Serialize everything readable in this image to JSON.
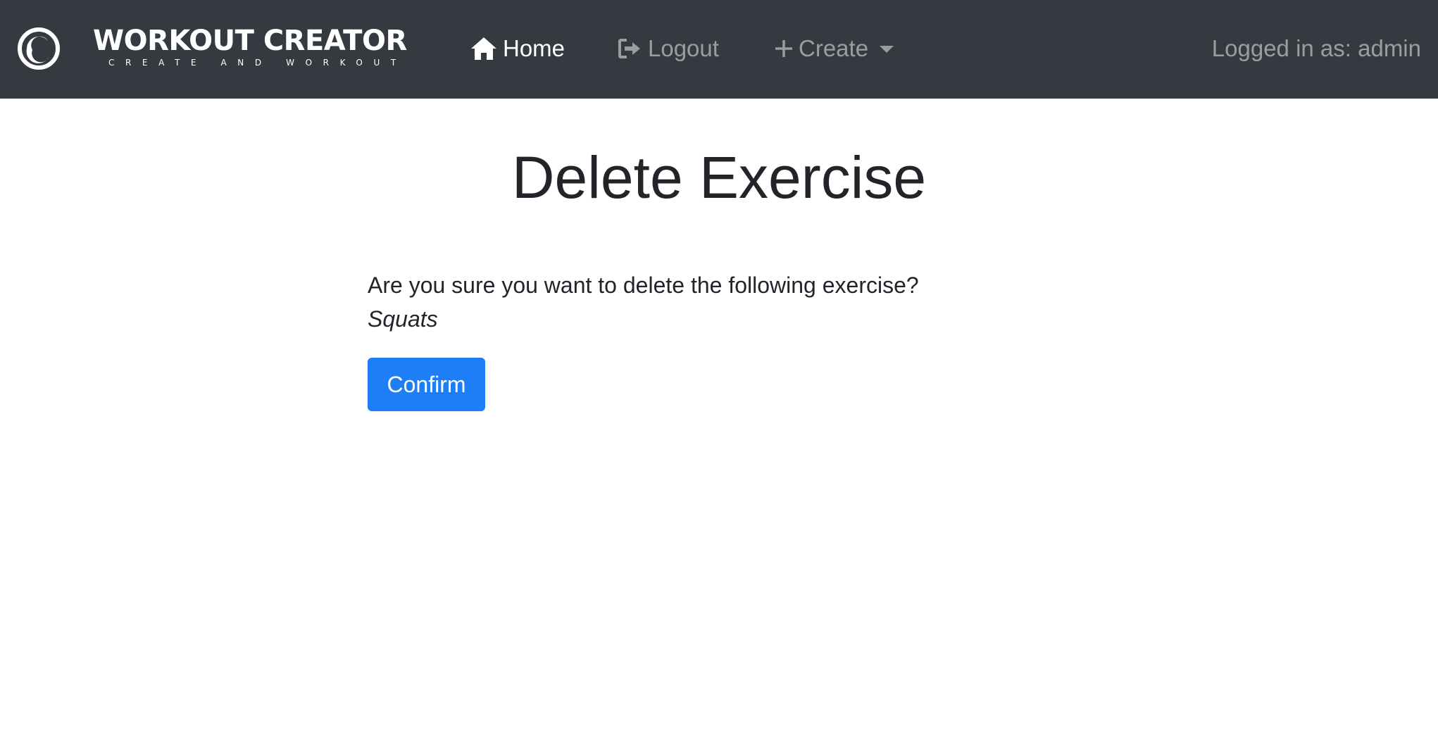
{
  "brand": {
    "title": "WORKOUT CREATOR",
    "tagline": "CREATE AND WORKOUT",
    "logo_icon": "swirl-logo-icon"
  },
  "nav": {
    "home_label": "Home",
    "home_icon": "home-icon",
    "logout_label": "Logout",
    "logout_icon": "sign-out-icon",
    "create_label": "Create",
    "create_icon": "plus-icon",
    "logged_in_text": "Logged in as: admin"
  },
  "main": {
    "title": "Delete Exercise",
    "prompt": "Are you sure you want to delete the following exercise?",
    "exercise_name": "Squats",
    "confirm_label": "Confirm"
  },
  "colors": {
    "navbar_bg": "#343a40",
    "primary": "#1e7ef7",
    "text": "#212529"
  }
}
